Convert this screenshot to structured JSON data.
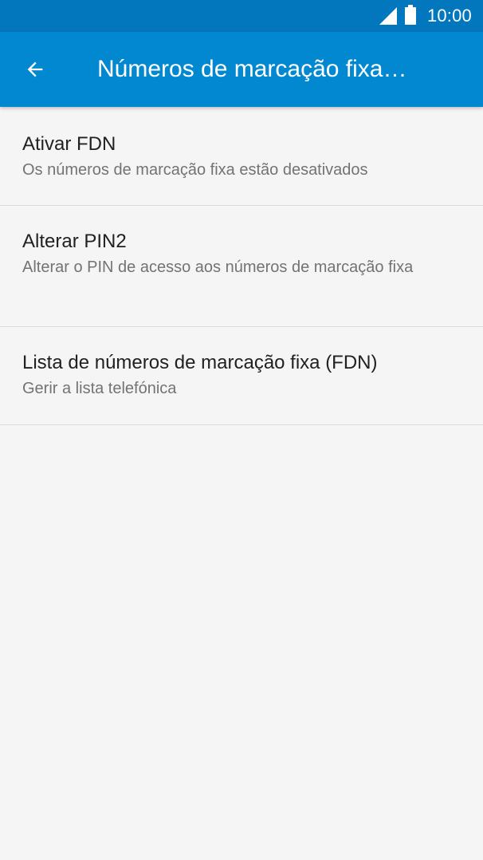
{
  "status_bar": {
    "time": "10:00",
    "signal_icon": "cell-signal-icon",
    "battery_icon": "battery-icon"
  },
  "app_bar": {
    "back_icon": "arrow-back-icon",
    "title": "Números de marcação fixa…"
  },
  "preferences": [
    {
      "title": "Ativar FDN",
      "summary": "Os números de marcação fixa estão desativados"
    },
    {
      "title": "Alterar PIN2",
      "summary": "Alterar o PIN de acesso aos números de marcação fixa"
    },
    {
      "title": "Lista de números de marcação fixa (FDN)",
      "summary": "Gerir a lista telefónica"
    }
  ],
  "colors": {
    "status_bar": "#0277bd",
    "app_bar": "#0288d1",
    "background": "#f5f5f5",
    "title_text": "#212121",
    "summary_text": "#737373",
    "divider": "#d9d9d9"
  }
}
